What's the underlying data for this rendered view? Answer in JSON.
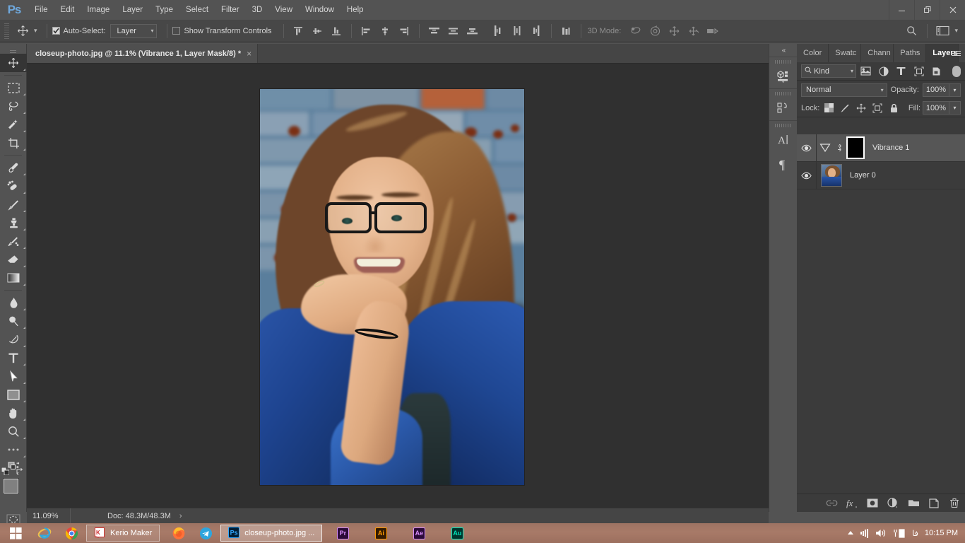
{
  "app": {
    "name": "Adobe Photoshop",
    "logo": "Ps"
  },
  "menubar": {
    "items": [
      "File",
      "Edit",
      "Image",
      "Layer",
      "Type",
      "Select",
      "Filter",
      "3D",
      "View",
      "Window",
      "Help"
    ]
  },
  "window_controls": {
    "minimize": "minimize-button",
    "restore": "restore-button",
    "close": "close-button"
  },
  "options_bar": {
    "tool_icon": "move-tool-icon",
    "auto_select_checked": true,
    "auto_select_label": "Auto-Select:",
    "auto_select_value": "Layer",
    "show_transform_label": "Show Transform Controls",
    "show_transform_checked": false,
    "align_group_1": [
      "align-top-edges",
      "align-vertical-centers",
      "align-bottom-edges"
    ],
    "align_group_2": [
      "align-left-edges",
      "align-horizontal-centers",
      "align-right-edges"
    ],
    "distribute_group_1": [
      "distribute-top-edges",
      "distribute-vertical-centers",
      "distribute-bottom-edges"
    ],
    "distribute_group_2": [
      "distribute-left-edges",
      "distribute-horizontal-centers",
      "distribute-right-edges"
    ],
    "auto_align_icon": "auto-align-layers",
    "mode3d_label": "3D Mode:",
    "mode3d_icons": [
      "orbit-3d-camera",
      "roll-3d-camera",
      "pan-3d-camera",
      "slide-3d-camera",
      "zoom-3d-camera"
    ],
    "search_icon": "search-icon",
    "workspace_icon": "workspace-switcher"
  },
  "document": {
    "tab_title": "closeup-photo.jpg @ 11.1% (Vibrance 1, Layer Mask/8) *",
    "close_glyph": "×"
  },
  "toolbar": {
    "tools": [
      {
        "name": "move-tool",
        "active": true
      },
      {
        "name": "rectangular-marquee-tool",
        "active": false
      },
      {
        "name": "lasso-tool",
        "active": false
      },
      {
        "name": "quick-selection-tool",
        "active": false
      },
      {
        "name": "crop-tool",
        "active": false
      },
      {
        "name": "eyedropper-tool",
        "active": false
      },
      {
        "name": "spot-healing-brush-tool",
        "active": false
      },
      {
        "name": "brush-tool",
        "active": false
      },
      {
        "name": "clone-stamp-tool",
        "active": false
      },
      {
        "name": "history-brush-tool",
        "active": false
      },
      {
        "name": "eraser-tool",
        "active": false
      },
      {
        "name": "gradient-tool",
        "active": false
      },
      {
        "name": "blur-tool",
        "active": false
      },
      {
        "name": "dodge-tool",
        "active": false
      },
      {
        "name": "pen-tool",
        "active": false
      },
      {
        "name": "horizontal-type-tool",
        "active": false
      },
      {
        "name": "path-selection-tool",
        "active": false
      },
      {
        "name": "rectangle-tool",
        "active": false
      },
      {
        "name": "hand-tool",
        "active": false
      },
      {
        "name": "zoom-tool",
        "active": false
      },
      {
        "name": "edit-toolbar-more",
        "active": false
      }
    ],
    "foreground_color": "#808080",
    "background_color": "#272727",
    "quick_mask_label": "edit-in-quick-mask-mode"
  },
  "status_bar": {
    "zoom": "11.09%",
    "doc_info": "Doc: 48.3M/48.3M",
    "arrow": "›"
  },
  "icon_dock": {
    "collapse_glyph": "«",
    "groups": [
      {
        "icon": "3d-panel-icon"
      },
      {
        "icon": "timeline-panel-icon"
      },
      {
        "icon": "character-panel-icon"
      },
      {
        "icon": "paragraph-panel-icon"
      }
    ]
  },
  "layers_panel": {
    "tabs": [
      {
        "label": "Color",
        "active": false
      },
      {
        "label": "Swatc",
        "active": false
      },
      {
        "label": "Chann",
        "active": false
      },
      {
        "label": "Paths",
        "active": false
      },
      {
        "label": "Layers",
        "active": true
      }
    ],
    "menu_icon": "panel-menu-icon",
    "filter": {
      "search_icon": "search-icon",
      "kind_label": "Kind",
      "caret": "⌄",
      "filter_icons": [
        "filter-pixel-layers",
        "filter-adjustment-layers",
        "filter-type-layers",
        "filter-shape-layers",
        "filter-smart-objects"
      ],
      "toggle_on": true
    },
    "blend_mode": "Normal",
    "opacity_label": "Opacity:",
    "opacity_value": "100%",
    "lock_label": "Lock:",
    "lock_icons": [
      "lock-transparent-pixels",
      "lock-image-pixels",
      "lock-position",
      "lock-artboard-nesting",
      "lock-all"
    ],
    "fill_label": "Fill:",
    "fill_value": "100%",
    "layers": [
      {
        "name": "Vibrance 1",
        "visible": true,
        "selected": true,
        "type": "adjustment",
        "has_mask": true,
        "mask_color": "#000000",
        "linked": true
      },
      {
        "name": "Layer 0",
        "visible": true,
        "selected": false,
        "type": "pixel",
        "has_mask": false,
        "linked": false
      }
    ],
    "footer_buttons": [
      {
        "name": "link-layers-button",
        "glyph": "⚭",
        "dim": true
      },
      {
        "name": "add-layer-style-button",
        "glyph": "fx",
        "dim": false
      },
      {
        "name": "add-layer-mask-button",
        "glyph": "mask",
        "dim": false
      },
      {
        "name": "new-adjustment-layer-button",
        "glyph": "half-circle",
        "dim": false
      },
      {
        "name": "new-group-button",
        "glyph": "folder",
        "dim": false
      },
      {
        "name": "new-layer-button",
        "glyph": "page",
        "dim": false
      },
      {
        "name": "delete-layer-button",
        "glyph": "trash",
        "dim": false
      }
    ]
  },
  "taskbar": {
    "start_label": "start-button",
    "pinned": [
      {
        "name": "internet-explorer-icon",
        "label": "e"
      },
      {
        "name": "google-chrome-icon",
        "label": ""
      }
    ],
    "windows": [
      {
        "name": "kerio-maker-window",
        "label": "Kerio Maker",
        "active": false,
        "icon": "kerio-icon"
      },
      {
        "name": "photoshop-window",
        "label": "closeup-photo.jpg ...",
        "active": true,
        "icon": "Ps"
      }
    ],
    "middle_icons": [
      {
        "name": "firefox-icon",
        "label": ""
      },
      {
        "name": "telegram-icon",
        "label": ""
      }
    ],
    "adobe_apps": [
      {
        "name": "premiere-pro-icon",
        "label": "Pr",
        "color": "#d58cf7",
        "bg": "#2b0a38"
      },
      {
        "name": "illustrator-icon",
        "label": "Ai",
        "color": "#ff9a00",
        "bg": "#331a00"
      },
      {
        "name": "after-effects-icon",
        "label": "Ae",
        "color": "#d58cf7",
        "bg": "#2b0a38"
      },
      {
        "name": "audition-icon",
        "label": "Au",
        "color": "#00e4bb",
        "bg": "#00342c"
      }
    ],
    "tray": {
      "show_hidden": "▲",
      "network_icon": "network-signal-icon",
      "volume_icon": "volume-icon",
      "battery_icon": "battery-icon",
      "language": "فا",
      "clock": "10:15 PM"
    }
  },
  "canvas": {
    "background": "#303030",
    "image_alt": "closeup portrait photo of smiling woman with glasses in denim jacket"
  }
}
